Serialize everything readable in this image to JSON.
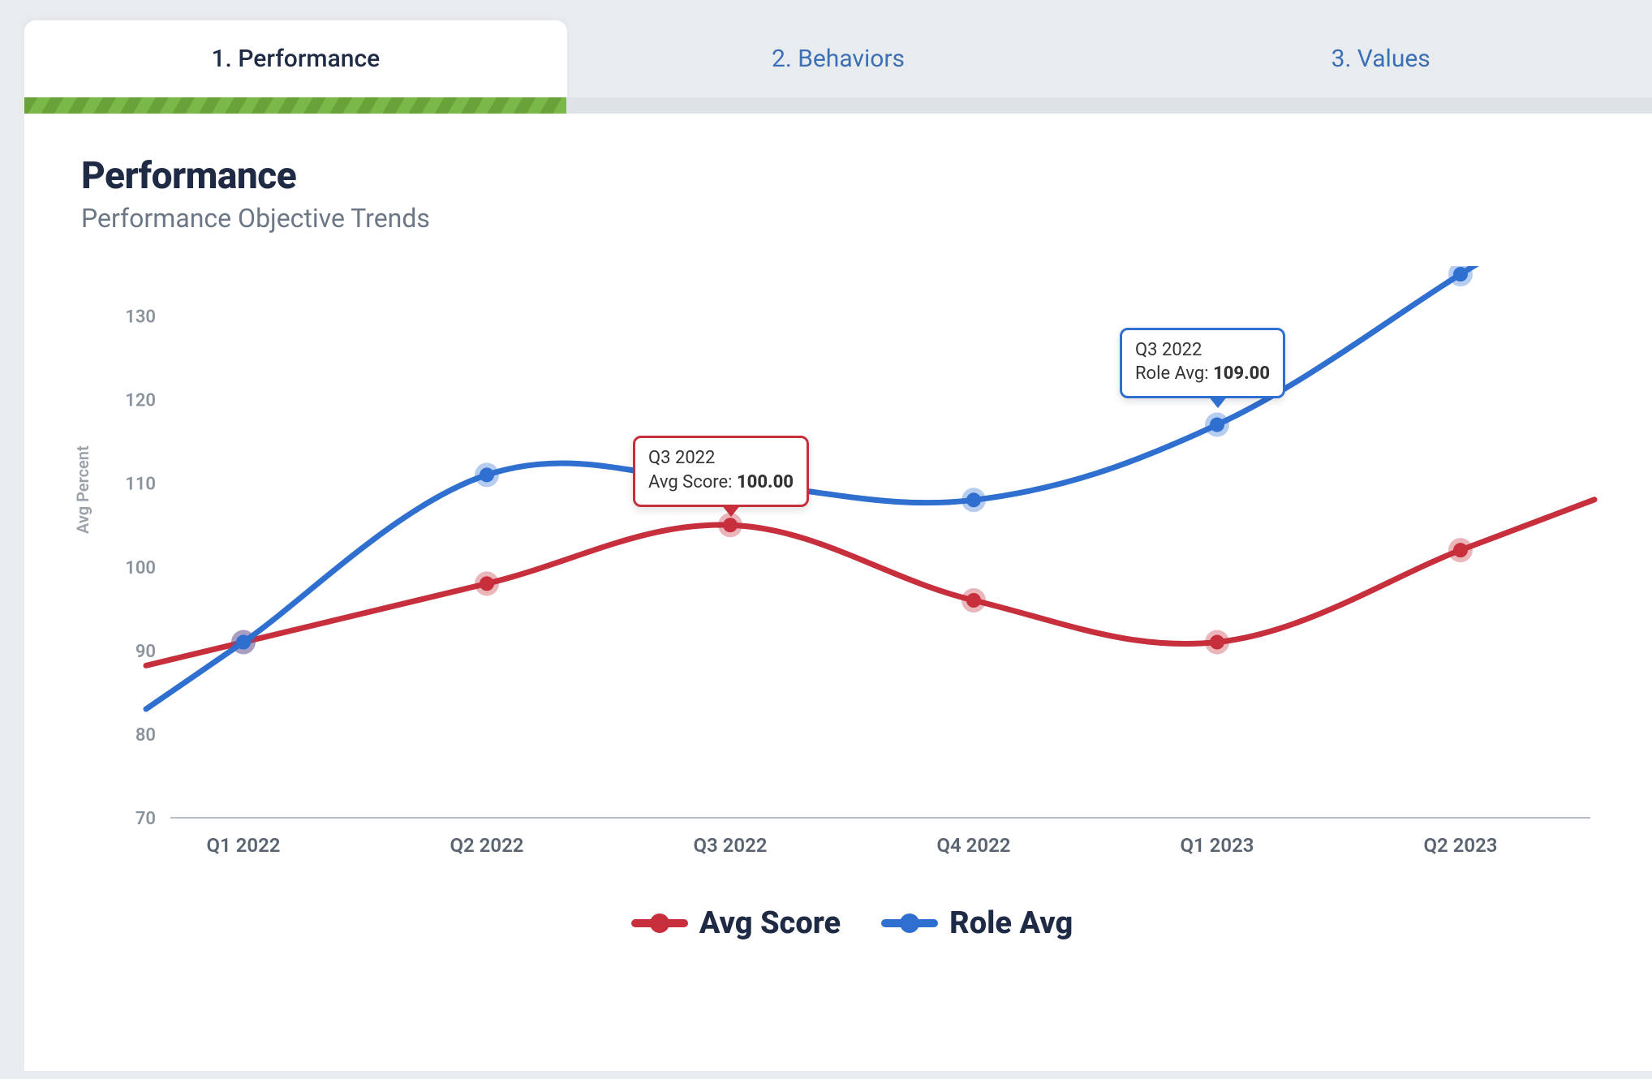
{
  "tabs": [
    {
      "label": "1. Performance",
      "active": true
    },
    {
      "label": "2. Behaviors",
      "active": false
    },
    {
      "label": "3. Values",
      "active": false
    }
  ],
  "title": "Performance",
  "subtitle": "Performance Objective Trends",
  "ylabel": "Avg Percent",
  "tooltips": {
    "red": {
      "period": "Q3 2022",
      "label": "Avg Score:",
      "value": "100.00",
      "color": "#c62f3b"
    },
    "blue": {
      "period": "Q3 2022",
      "label": "Role Avg:",
      "value": "109.00",
      "color": "#2f6fd0"
    }
  },
  "legend": [
    {
      "name": "Avg Score",
      "color": "#c62f3b"
    },
    {
      "name": "Role Avg",
      "color": "#2f6fd0"
    }
  ],
  "chart_data": {
    "type": "line",
    "categories": [
      "Q1 2022",
      "Q2 2022",
      "Q3 2022",
      "Q4 2022",
      "Q1 2023",
      "Q2 2023"
    ],
    "series": [
      {
        "name": "Avg Score",
        "color": "#c62f3b",
        "values": [
          91,
          98,
          105,
          96,
          91,
          102
        ]
      },
      {
        "name": "Role Avg",
        "color": "#2f6fd0",
        "values": [
          91,
          111,
          110,
          108,
          117,
          135
        ]
      }
    ],
    "xlabel": "",
    "ylabel": "Avg Percent",
    "ylim": [
      70,
      135
    ],
    "yticks": [
      70,
      80,
      90,
      100,
      110,
      120,
      130
    ],
    "title": ""
  }
}
